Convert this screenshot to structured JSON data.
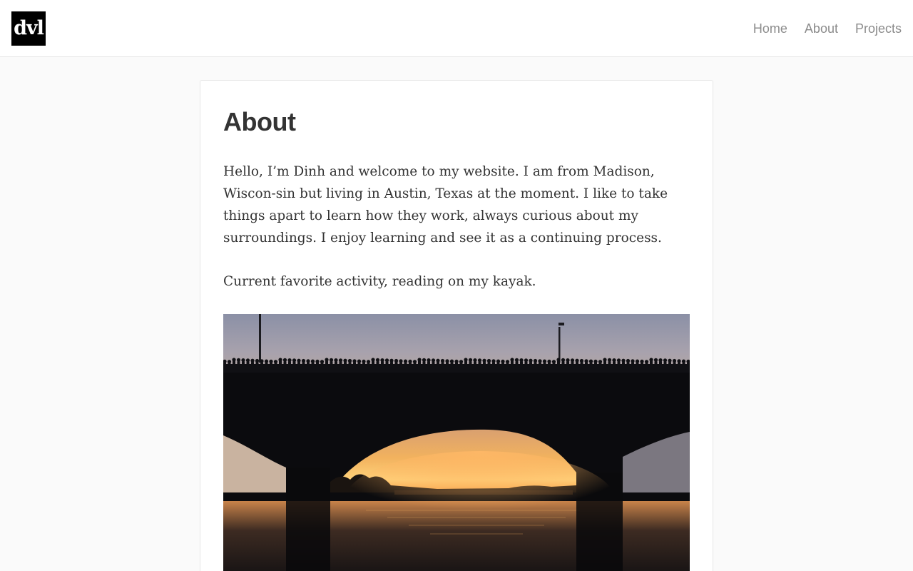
{
  "header": {
    "logo_text": "dvl",
    "nav": [
      {
        "label": "Home"
      },
      {
        "label": "About"
      },
      {
        "label": "Projects"
      }
    ]
  },
  "main": {
    "title": "About",
    "paragraphs": [
      "Hello, I’m Dinh and welcome to my website. I am from Madison, Wiscon-sin but living in Austin, Texas at the moment. I like to take things apart to learn how they work, always curious about my surroundings. I enjoy learning and see it as a continuing process.",
      "Current favorite activity, reading on my kayak."
    ],
    "photo": {
      "description": "bridge-over-river-at-sunset-photo"
    }
  },
  "colors": {
    "logo_bg": "#000000",
    "nav_text": "#8c8c8c",
    "heading_text": "#333333",
    "page_bg": "#fafafa",
    "card_bg": "#ffffff"
  }
}
